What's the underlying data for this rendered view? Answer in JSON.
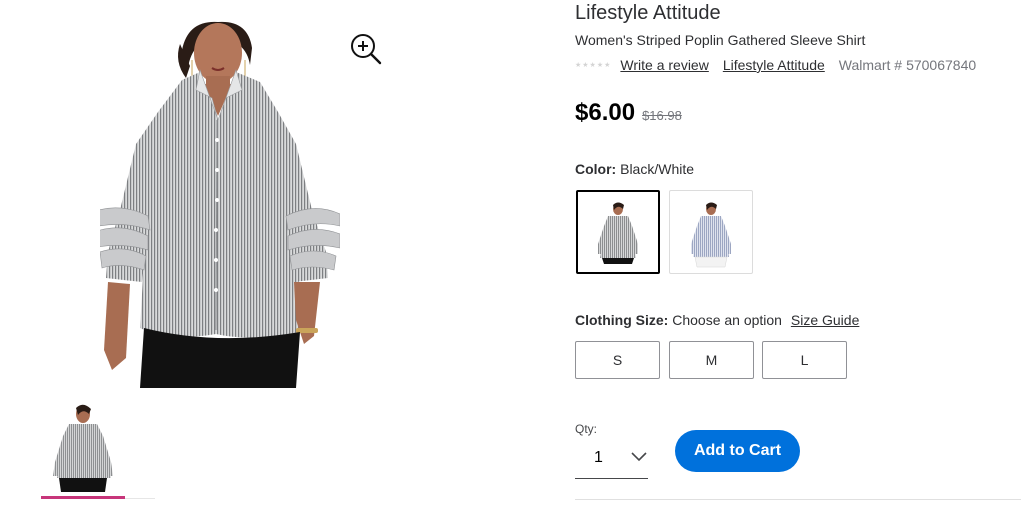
{
  "product": {
    "brand_title": "Lifestyle Attitude",
    "name": "Women's Striped Poplin Gathered Sleeve Shirt",
    "rating_stars": "★★★★★",
    "write_review": "Write a review",
    "brand_link": "Lifestyle Attitude",
    "sku_label": "Walmart #",
    "sku": "570067840"
  },
  "price": {
    "current": "$6.00",
    "was": "$16.98"
  },
  "color": {
    "label": "Color:",
    "selected": "Black/White",
    "swatches": [
      "black-white",
      "blue-white"
    ]
  },
  "size": {
    "label": "Clothing Size:",
    "prompt": "Choose an option",
    "guide": "Size Guide",
    "options": [
      "S",
      "M",
      "L"
    ]
  },
  "qty": {
    "label": "Qty:",
    "value": "1"
  },
  "cart": {
    "button": "Add to Cart"
  },
  "colors": {
    "accent": "#0071dc",
    "thumb_active": "#c7357a",
    "text": "#2e2f32",
    "muted": "#74767c"
  },
  "icons": [
    "zoom-in-icon",
    "chevron-down-icon"
  ]
}
